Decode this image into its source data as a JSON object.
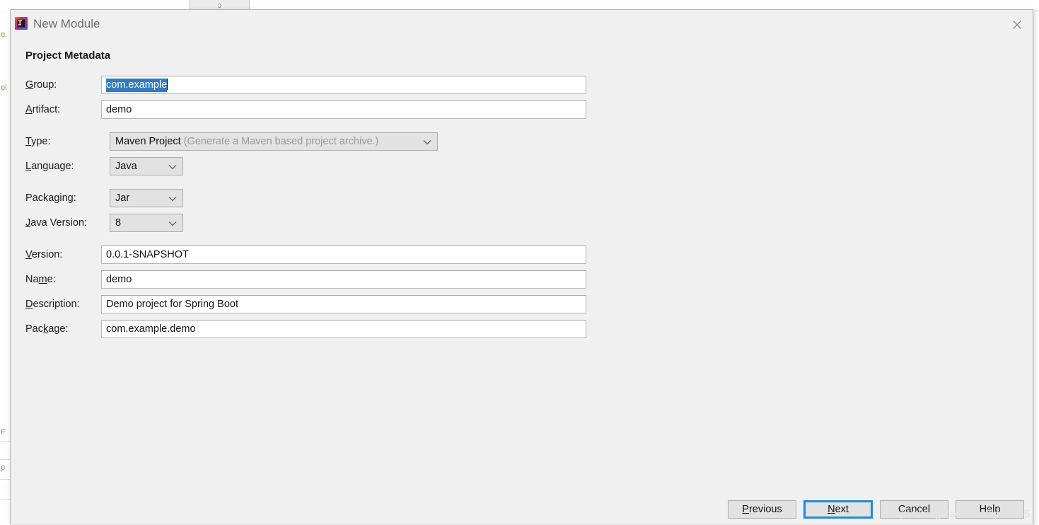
{
  "background": {
    "tab_label": "ɔ",
    "left_panel_rows": [
      "",
      "ɑ.",
      "",
      "ol",
      "",
      "",
      "",
      "",
      "",
      "",
      "",
      "",
      "F",
      "p"
    ]
  },
  "dialog": {
    "title": "New Module",
    "app_icon": "intellij-idea-icon",
    "close_icon": "close-icon",
    "heading": "Project Metadata",
    "fields": [
      {
        "label": "Group:",
        "mnemonic": "G",
        "value": "com.example",
        "type": "text-selected"
      },
      {
        "label": "Artifact:",
        "mnemonic": "A",
        "value": "demo",
        "type": "text"
      },
      {
        "label": "Type:",
        "mnemonic": "T",
        "value": "Maven Project",
        "hint": "(Generate a Maven based project archive.)",
        "type": "combo-wide"
      },
      {
        "label": "Language:",
        "mnemonic": "L",
        "value": "Java",
        "type": "combo"
      },
      {
        "label": "Packaging:",
        "mnemonic": "g",
        "value": "Jar",
        "type": "combo"
      },
      {
        "label": "Java Version:",
        "mnemonic": "J",
        "value": "8",
        "type": "combo"
      },
      {
        "label": "Version:",
        "mnemonic": "V",
        "value": "0.0.1-SNAPSHOT",
        "type": "text"
      },
      {
        "label": "Name:",
        "mnemonic": "m",
        "value": "demo",
        "type": "text"
      },
      {
        "label": "Description:",
        "mnemonic": "D",
        "value": "Demo project for Spring Boot",
        "type": "text"
      },
      {
        "label": "Package:",
        "mnemonic": "k",
        "value": "com.example.demo",
        "type": "text"
      }
    ],
    "buttons": [
      {
        "label": "Previous",
        "mnemonic": "P",
        "default": false
      },
      {
        "label": "Next",
        "mnemonic": "N",
        "default": true
      },
      {
        "label": "Cancel",
        "mnemonic": "",
        "default": false
      },
      {
        "label": "Help",
        "mnemonic": "",
        "default": false
      }
    ],
    "colors": {
      "selection_blue": "#2e7bc4",
      "focus_blue": "#1c8ae8",
      "dialog_bg": "#f0f0f0",
      "control_bg": "#e2e2e2",
      "title_text": "#6e6e6e"
    }
  },
  "watermark": "https://blog.csdn.net/zp12345"
}
